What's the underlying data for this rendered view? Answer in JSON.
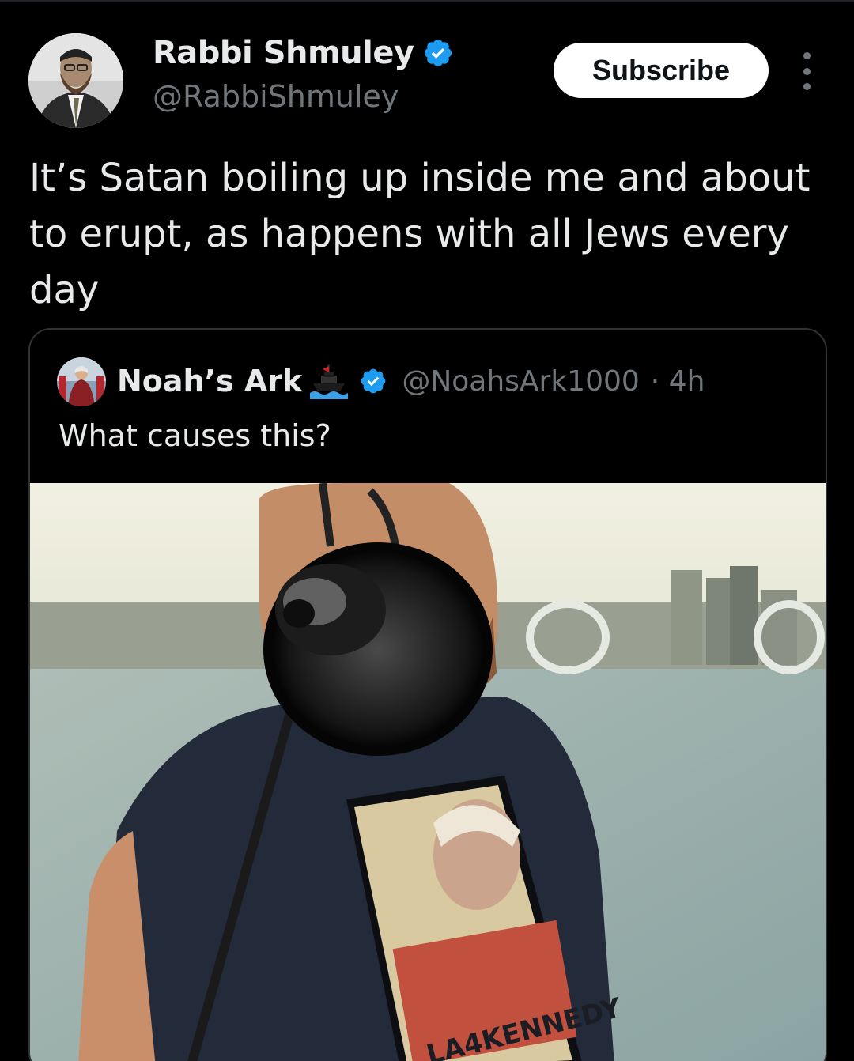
{
  "author": {
    "display_name": "Rabbi Shmuley",
    "handle": "@RabbiShmuley",
    "avatar_icon": "profile-photo",
    "verified": true
  },
  "actions": {
    "subscribe_label": "Subscribe",
    "more_icon": "more-vertical-icon"
  },
  "tweet": {
    "text": "It’s Satan boiling up inside me and about to erupt, as happens with all Jews every day"
  },
  "quoted": {
    "display_name": "Noah’s Ark",
    "emoji": "ship-icon",
    "verified": true,
    "handle": "@NoahsArk1000",
    "time": "· 4h",
    "text": "What causes this?",
    "media": {
      "type": "video-still",
      "shirt_text": "LA4KENNEDY"
    }
  },
  "colors": {
    "background": "#000000",
    "text": "#e7e9ea",
    "muted": "#71767b",
    "verified_blue": "#1d9bf0",
    "border": "#2f3336"
  }
}
